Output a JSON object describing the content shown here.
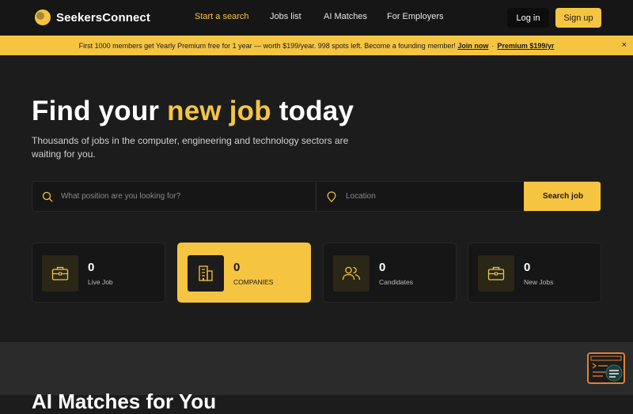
{
  "brand": {
    "name": "SeekersConnect"
  },
  "nav": {
    "links": [
      "Start a search",
      "Jobs list",
      "AI Matches",
      "For Employers"
    ],
    "login": "Log in",
    "signup": "Sign up"
  },
  "banner": {
    "text": "First 1000 members get Yearly Premium free for 1 year — worth $199/year. 998 spots left. Become a founding member!",
    "join_link": "Join now",
    "separator": "·",
    "premium_link": "Premium $199/yr",
    "close": "×"
  },
  "hero": {
    "title_start": "Find your ",
    "title_accent": "new job",
    "title_end": " today",
    "subtitle": "Thousands of jobs in the computer, engineering and technology sectors are waiting for you."
  },
  "search": {
    "position_placeholder": "What position are you looking for?",
    "location_placeholder": "Location",
    "button": "Search job"
  },
  "stats": [
    {
      "value": "0",
      "label": "Live Job",
      "icon": "briefcase-icon"
    },
    {
      "value": "0",
      "label": "COMPANIES",
      "icon": "building-icon"
    },
    {
      "value": "0",
      "label": "Candidates",
      "icon": "users-icon"
    },
    {
      "value": "0",
      "label": "New Jobs",
      "icon": "briefcase-icon"
    }
  ],
  "section2": {
    "title": "AI Matches for You"
  },
  "colors": {
    "accent": "#f5c542",
    "background": "#1c1c1c",
    "nav": "#161616",
    "widget": "#e0813a"
  }
}
